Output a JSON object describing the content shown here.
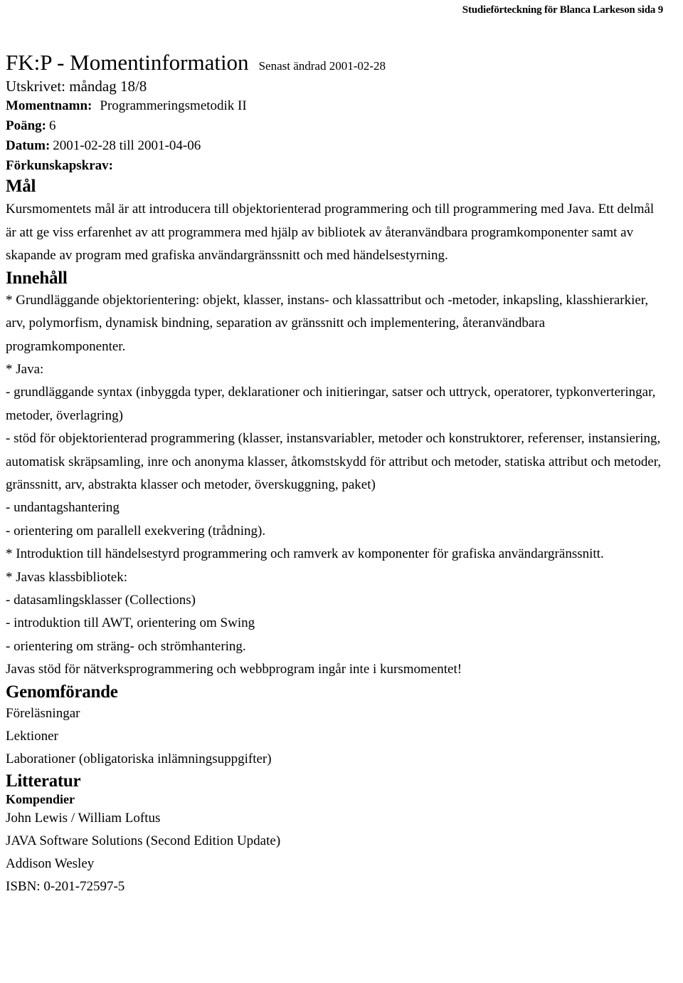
{
  "header": {
    "running_title": "Studieförteckning för Blanca Larkeson sida 9"
  },
  "title_block": {
    "title": "FK:P - Momentinformation",
    "last_modified": "Senast ändrad 2001-02-28",
    "printed": "Utskrivet: måndag 18/8"
  },
  "meta": {
    "momentnamn_label": "Momentnamn:",
    "momentnamn_value": "Programmeringsmetodik II",
    "poang_label": "Poäng:",
    "poang_value": "6",
    "datum_label": "Datum:",
    "datum_value": "2001-02-28 till 2001-04-06",
    "forkunskapskrav_label": "Förkunskapskrav:"
  },
  "mal": {
    "heading": "Mål",
    "paragraph": "Kursmomentets mål är att introducera till objektorienterad programmering och till programmering med Java. Ett delmål är att ge viss erfarenhet av att programmera med hjälp av bibliotek av återanvändbara programkomponenter samt av skapande av program med grafiska användargränssnitt och med händelsestyrning."
  },
  "innehall": {
    "heading": "Innehåll",
    "oo_paragraph": "* Grundläggande objektorientering: objekt, klasser, instans- och klassattribut och -metoder, inkapsling, klasshierarkier, arv, polymorfism, dynamisk bindning, separation av gränssnitt och implementering, återanvändbara programkomponenter.",
    "java_heading": "* Java:",
    "java_items": [
      "- grundläggande syntax (inbyggda typer, deklarationer och initieringar, satser och uttryck, operatorer, typkonverteringar, metoder, överlagring)",
      "- stöd för objektorienterad programmering (klasser, instansvariabler, metoder och konstruktorer, referenser, instansiering, automatisk skräpsamling, inre och anonyma klasser, åtkomstskydd för attribut och metoder, statiska attribut och metoder, gränssnitt, arv, abstrakta klasser och metoder, överskuggning, paket)",
      "- undantagshantering",
      "- orientering om parallell exekvering (trådning)."
    ],
    "gui_line": "* Introduktion till händelsestyrd programmering och ramverk av komponenter för grafiska användargränssnitt.",
    "klassbibliotek_heading": "* Javas klassbibliotek:",
    "klassbibliotek_items": [
      "- datasamlingsklasser (Collections)",
      "- introduktion till AWT, orientering om Swing",
      "- orientering om sträng- och strömhantering."
    ],
    "note": "Javas stöd för nätverksprogrammering och webbprogram ingår inte i kursmomentet!"
  },
  "genomforande": {
    "heading": "Genomförande",
    "items": [
      "Föreläsningar",
      "Lektioner",
      "Laborationer (obligatoriska inlämningsuppgifter)"
    ]
  },
  "litteratur": {
    "heading": "Litteratur",
    "sub_heading": "Kompendier",
    "reference_lines": [
      "John Lewis / William Loftus",
      "JAVA Software Solutions (Second Edition Update)",
      "Addison Wesley",
      "ISBN: 0-201-72597-5"
    ]
  }
}
